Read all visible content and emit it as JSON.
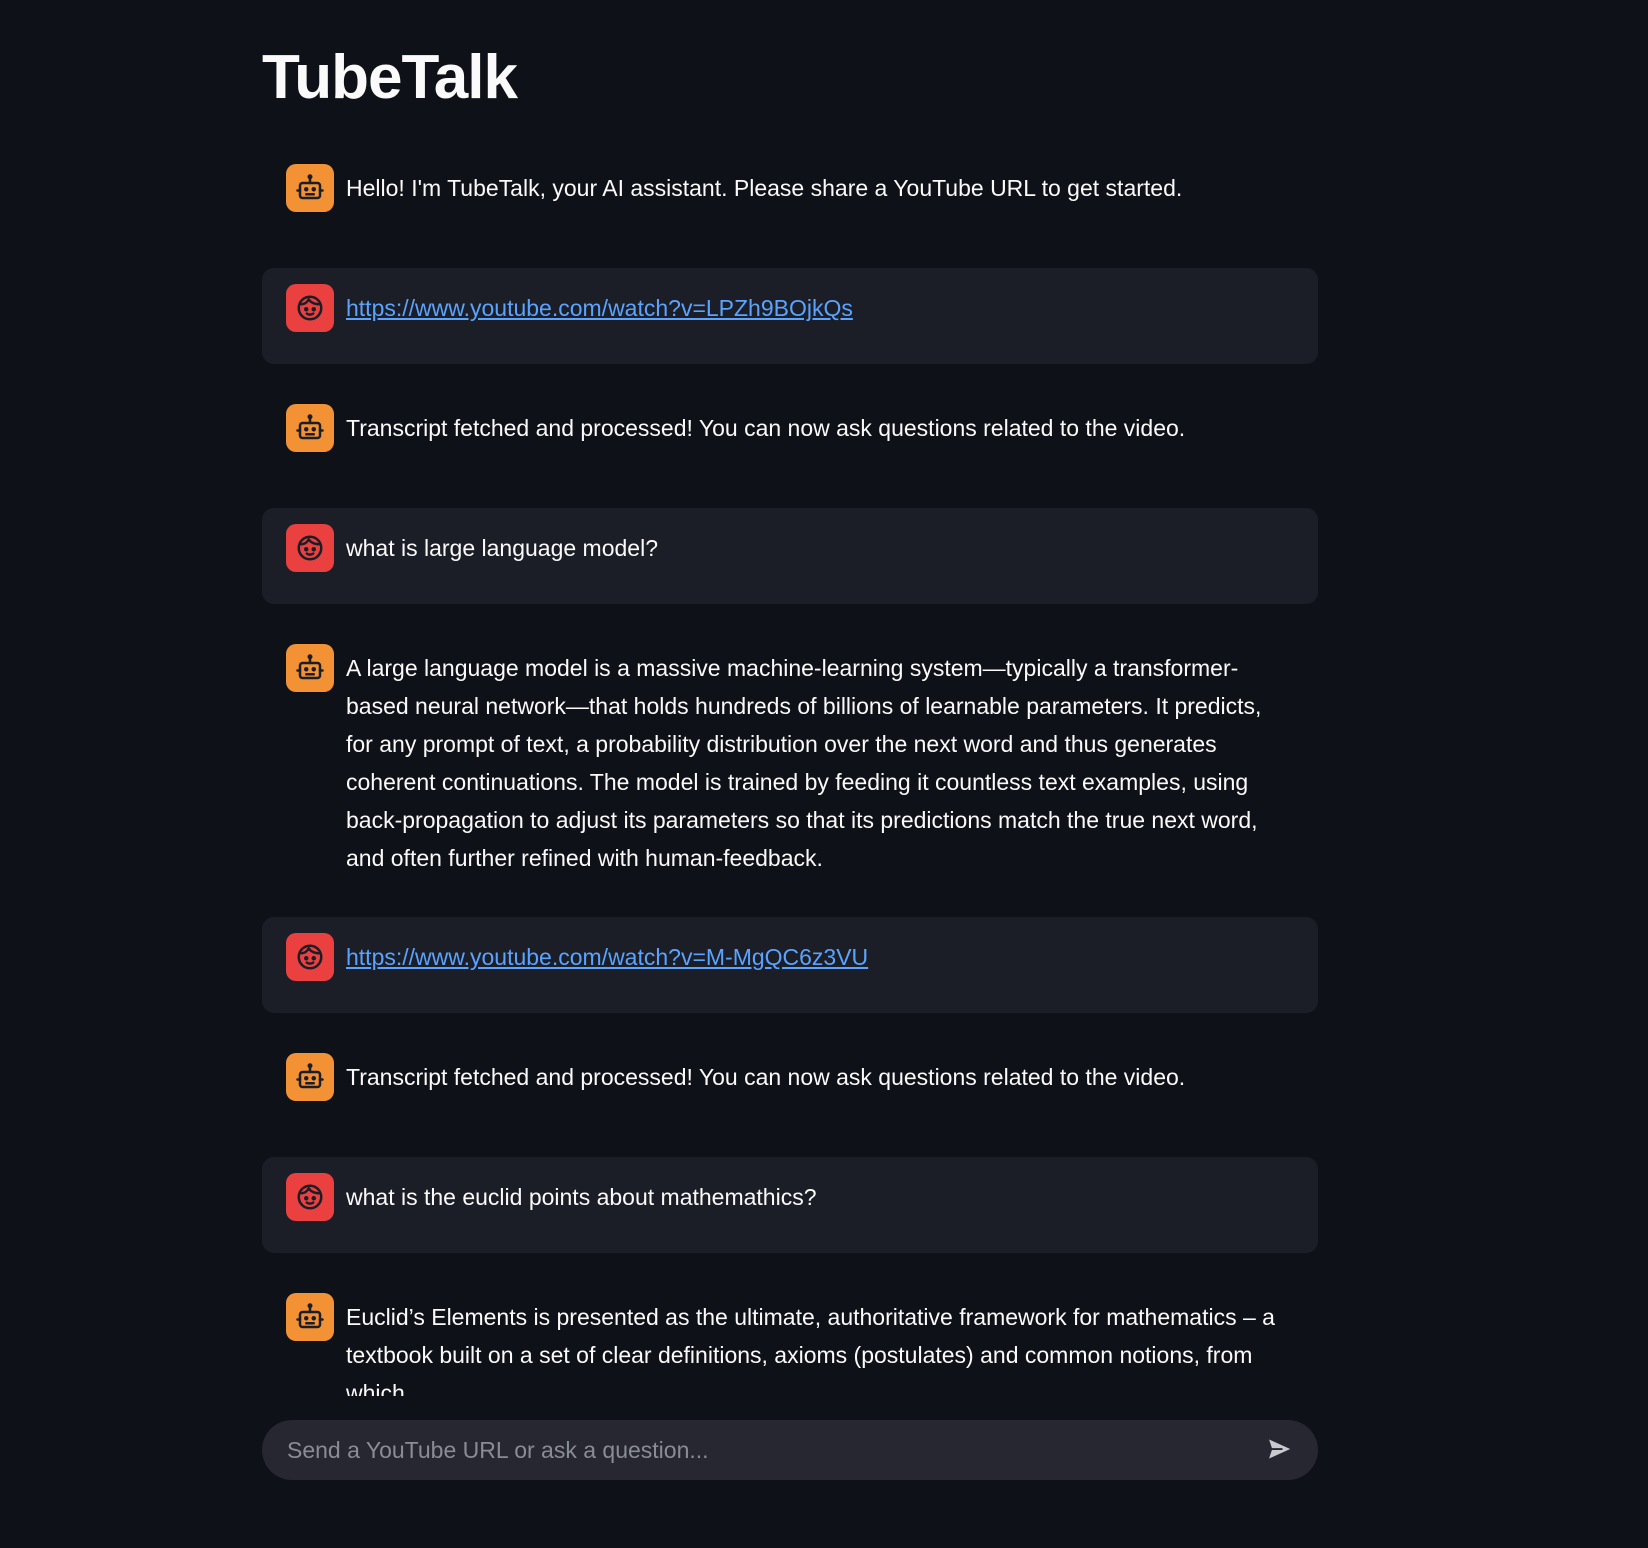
{
  "app": {
    "title": "TubeTalk"
  },
  "colors": {
    "background": "#0e1117",
    "user_bubble": "#1b1e26",
    "bot_avatar": "#f39235",
    "user_avatar": "#ea4040",
    "link": "#5aa3ff",
    "input_background": "#262730"
  },
  "messages": [
    {
      "role": "assistant",
      "avatar_icon": "robot-icon",
      "text": "Hello! I'm TubeTalk, your AI assistant. Please share a YouTube URL to get started."
    },
    {
      "role": "user",
      "avatar_icon": "face-icon",
      "text": "https://www.youtube.com/watch?v=LPZh9BOjkQs",
      "is_link": true
    },
    {
      "role": "assistant",
      "avatar_icon": "robot-icon",
      "text": "Transcript fetched and processed! You can now ask questions related to the video."
    },
    {
      "role": "user",
      "avatar_icon": "face-icon",
      "text": "what is large language model?"
    },
    {
      "role": "assistant",
      "avatar_icon": "robot-icon",
      "text": "A large language model is a massive machine-learning system—typically a transformer-based neural network—that holds hundreds of billions of learnable parameters. It predicts, for any prompt of text, a probability distribution over the next word and thus generates coherent continuations. The model is trained by feeding it countless text examples, using back-propagation to adjust its parameters so that its predictions match the true next word, and often further refined with human-feedback."
    },
    {
      "role": "user",
      "avatar_icon": "face-icon",
      "text": "https://www.youtube.com/watch?v=M-MgQC6z3VU",
      "is_link": true
    },
    {
      "role": "assistant",
      "avatar_icon": "robot-icon",
      "text": "Transcript fetched and processed! You can now ask questions related to the video."
    },
    {
      "role": "user",
      "avatar_icon": "face-icon",
      "text": "what is the euclid points about mathemathics?"
    },
    {
      "role": "assistant",
      "avatar_icon": "robot-icon",
      "text": "Euclid’s Elements is presented as the ultimate, authoritative framework for mathematics – a textbook built on a set of clear definitions, axioms (postulates) and common notions, from which"
    }
  ],
  "input": {
    "placeholder": "Send a YouTube URL or ask a question...",
    "value": "",
    "send_icon": "send-icon"
  }
}
